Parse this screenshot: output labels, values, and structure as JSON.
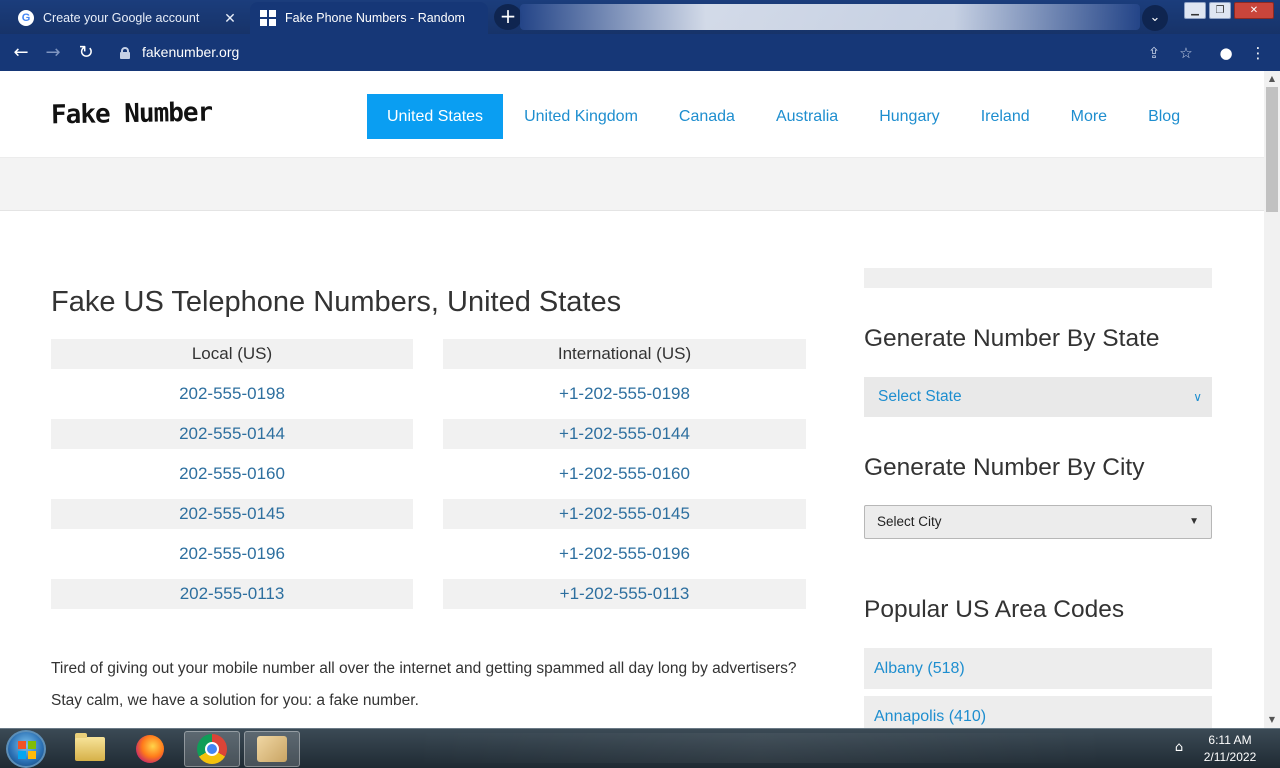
{
  "browser": {
    "tabs": [
      {
        "title": "Create your Google account",
        "active": false,
        "icon": "google-icon"
      },
      {
        "title": "Fake Phone Numbers - Random",
        "active": true,
        "icon": "grid-icon"
      }
    ],
    "close_glyph": "✕",
    "new_tab_glyph": "+",
    "tab_search_glyph": "⌄",
    "url": "fakenumber.org"
  },
  "site": {
    "logo": "Fake Number",
    "nav": [
      "United States",
      "United Kingdom",
      "Canada",
      "Australia",
      "Hungary",
      "Ireland",
      "More",
      "Blog"
    ],
    "active_nav": "United States"
  },
  "main": {
    "heading": "Fake US Telephone Numbers, United States",
    "table": {
      "headers": [
        "Local (US)",
        "International (US)"
      ],
      "local": [
        "202-555-0198",
        "202-555-0144",
        "202-555-0160",
        "202-555-0145",
        "202-555-0196",
        "202-555-0113"
      ],
      "international": [
        "+1-202-555-0198",
        "+1-202-555-0144",
        "+1-202-555-0160",
        "+1-202-555-0145",
        "+1-202-555-0196",
        "+1-202-555-0113"
      ]
    },
    "paragraph": "Tired of giving out your mobile number all over the internet and getting spammed all day long by advertisers? Stay calm, we have a solution for you: a fake number."
  },
  "sidebar": {
    "by_state_heading": "Generate Number By State",
    "state_select": "Select State",
    "by_city_heading": "Generate Number By City",
    "city_select": "Select City",
    "area_codes_heading": "Popular US Area Codes",
    "area_codes": [
      "Albany (518)",
      "Annapolis (410)"
    ]
  },
  "taskbar": {
    "time": "6:11 AM",
    "date": "2/11/2022"
  },
  "colors": {
    "accent": "#0a9ef2",
    "link": "#1e8ecf",
    "number": "#2d6f9f",
    "chrome": "#163777"
  }
}
